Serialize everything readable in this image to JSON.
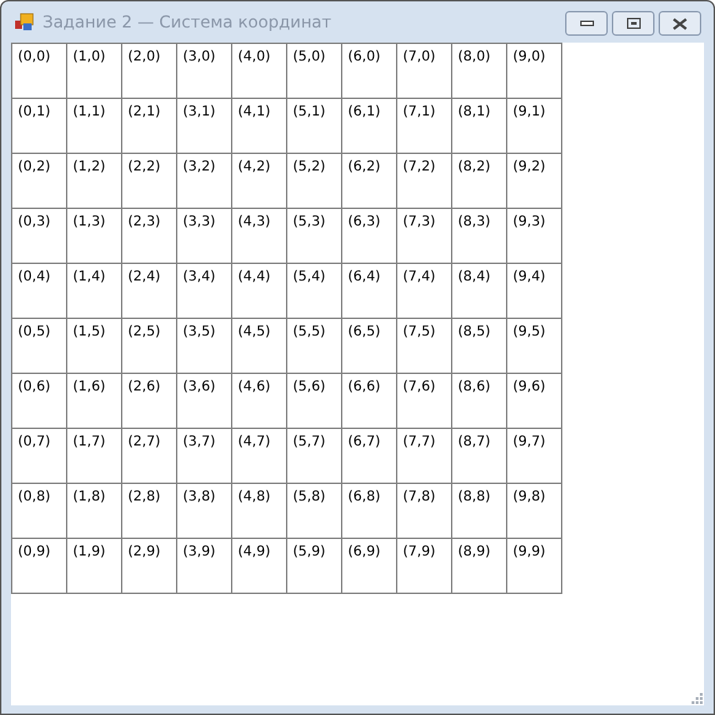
{
  "window": {
    "title": "Задание 2 — Система координат"
  },
  "grid": {
    "rows": [
      [
        "(0,0)",
        "(1,0)",
        "(2,0)",
        "(3,0)",
        "(4,0)",
        "(5,0)",
        "(6,0)",
        "(7,0)",
        "(8,0)",
        "(9,0)"
      ],
      [
        "(0,1)",
        "(1,1)",
        "(2,1)",
        "(3,1)",
        "(4,1)",
        "(5,1)",
        "(6,1)",
        "(7,1)",
        "(8,1)",
        "(9,1)"
      ],
      [
        "(0,2)",
        "(1,2)",
        "(2,2)",
        "(3,2)",
        "(4,2)",
        "(5,2)",
        "(6,2)",
        "(7,2)",
        "(8,2)",
        "(9,2)"
      ],
      [
        "(0,3)",
        "(1,3)",
        "(2,3)",
        "(3,3)",
        "(4,3)",
        "(5,3)",
        "(6,3)",
        "(7,3)",
        "(8,3)",
        "(9,3)"
      ],
      [
        "(0,4)",
        "(1,4)",
        "(2,4)",
        "(3,4)",
        "(4,4)",
        "(5,4)",
        "(6,4)",
        "(7,4)",
        "(8,4)",
        "(9,4)"
      ],
      [
        "(0,5)",
        "(1,5)",
        "(2,5)",
        "(3,5)",
        "(4,5)",
        "(5,5)",
        "(6,5)",
        "(7,5)",
        "(8,5)",
        "(9,5)"
      ],
      [
        "(0,6)",
        "(1,6)",
        "(2,6)",
        "(3,6)",
        "(4,6)",
        "(5,6)",
        "(6,6)",
        "(7,6)",
        "(8,6)",
        "(9,6)"
      ],
      [
        "(0,7)",
        "(1,7)",
        "(2,7)",
        "(3,7)",
        "(4,7)",
        "(5,7)",
        "(6,7)",
        "(7,7)",
        "(8,7)",
        "(9,7)"
      ],
      [
        "(0,8)",
        "(1,8)",
        "(2,8)",
        "(3,8)",
        "(4,8)",
        "(5,8)",
        "(6,8)",
        "(7,8)",
        "(8,8)",
        "(9,8)"
      ],
      [
        "(0,9)",
        "(1,9)",
        "(2,9)",
        "(3,9)",
        "(4,9)",
        "(5,9)",
        "(6,9)",
        "(7,9)",
        "(8,9)",
        "(9,9)"
      ]
    ]
  }
}
